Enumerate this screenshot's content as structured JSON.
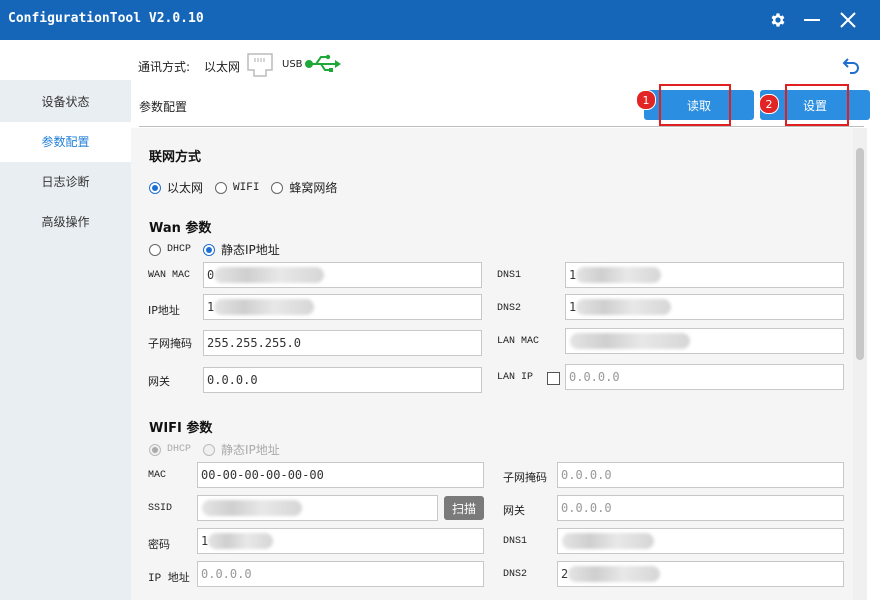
{
  "window": {
    "title": "ConfigurationTool V2.0.10"
  },
  "comm": {
    "label": "通讯方式:",
    "ethernet": "以太网",
    "usb": "USB"
  },
  "sidebar": {
    "items": [
      {
        "label": "设备状态"
      },
      {
        "label": "参数配置"
      },
      {
        "label": "日志诊断"
      },
      {
        "label": "高级操作"
      }
    ]
  },
  "header": {
    "title": "参数配置",
    "read_label": "读取",
    "set_label": "设置",
    "badge_read": "1",
    "badge_set": "2"
  },
  "network": {
    "title": "联网方式",
    "options": [
      "以太网",
      "WIFI",
      "蜂窝网络"
    ],
    "selected": "以太网"
  },
  "wan": {
    "title": "Wan 参数",
    "modes": [
      "DHCP",
      "静态IP地址"
    ],
    "selected_mode": "静态IP地址",
    "labels": {
      "wan_mac": "WAN MAC",
      "ip": "IP地址",
      "mask": "子网掩码",
      "gateway": "网关",
      "dns1": "DNS1",
      "dns2": "DNS2",
      "lan_mac": "LAN MAC",
      "lan_ip": "LAN IP"
    },
    "values": {
      "wan_mac": "0",
      "ip": "1",
      "mask": "255.255.255.0",
      "gateway": "0.0.0.0",
      "dns1": "1",
      "dns2": "1",
      "lan_mac": "",
      "lan_ip": "0.0.0.0"
    }
  },
  "wifi": {
    "title": "WIFI 参数",
    "modes": [
      "DHCP",
      "静态IP地址"
    ],
    "selected_mode": "DHCP",
    "labels": {
      "mac": "MAC",
      "ssid": "SSID",
      "password": "密码",
      "ip": "IP 地址",
      "mask": "子网掩码",
      "gateway": "网关",
      "dns1": "DNS1",
      "dns2": "DNS2"
    },
    "values": {
      "mac": "00-00-00-00-00-00",
      "ssid": "",
      "password": "1",
      "ip": "0.0.0.0",
      "mask": "0.0.0.0",
      "gateway": "0.0.0.0",
      "dns1": "",
      "dns2": "2"
    },
    "scan_label": "扫描"
  },
  "colors": {
    "titlebar": "#1565b8",
    "accent": "#2c8ee0",
    "highlight": "#e02020",
    "usb_green": "#1fa83a"
  }
}
